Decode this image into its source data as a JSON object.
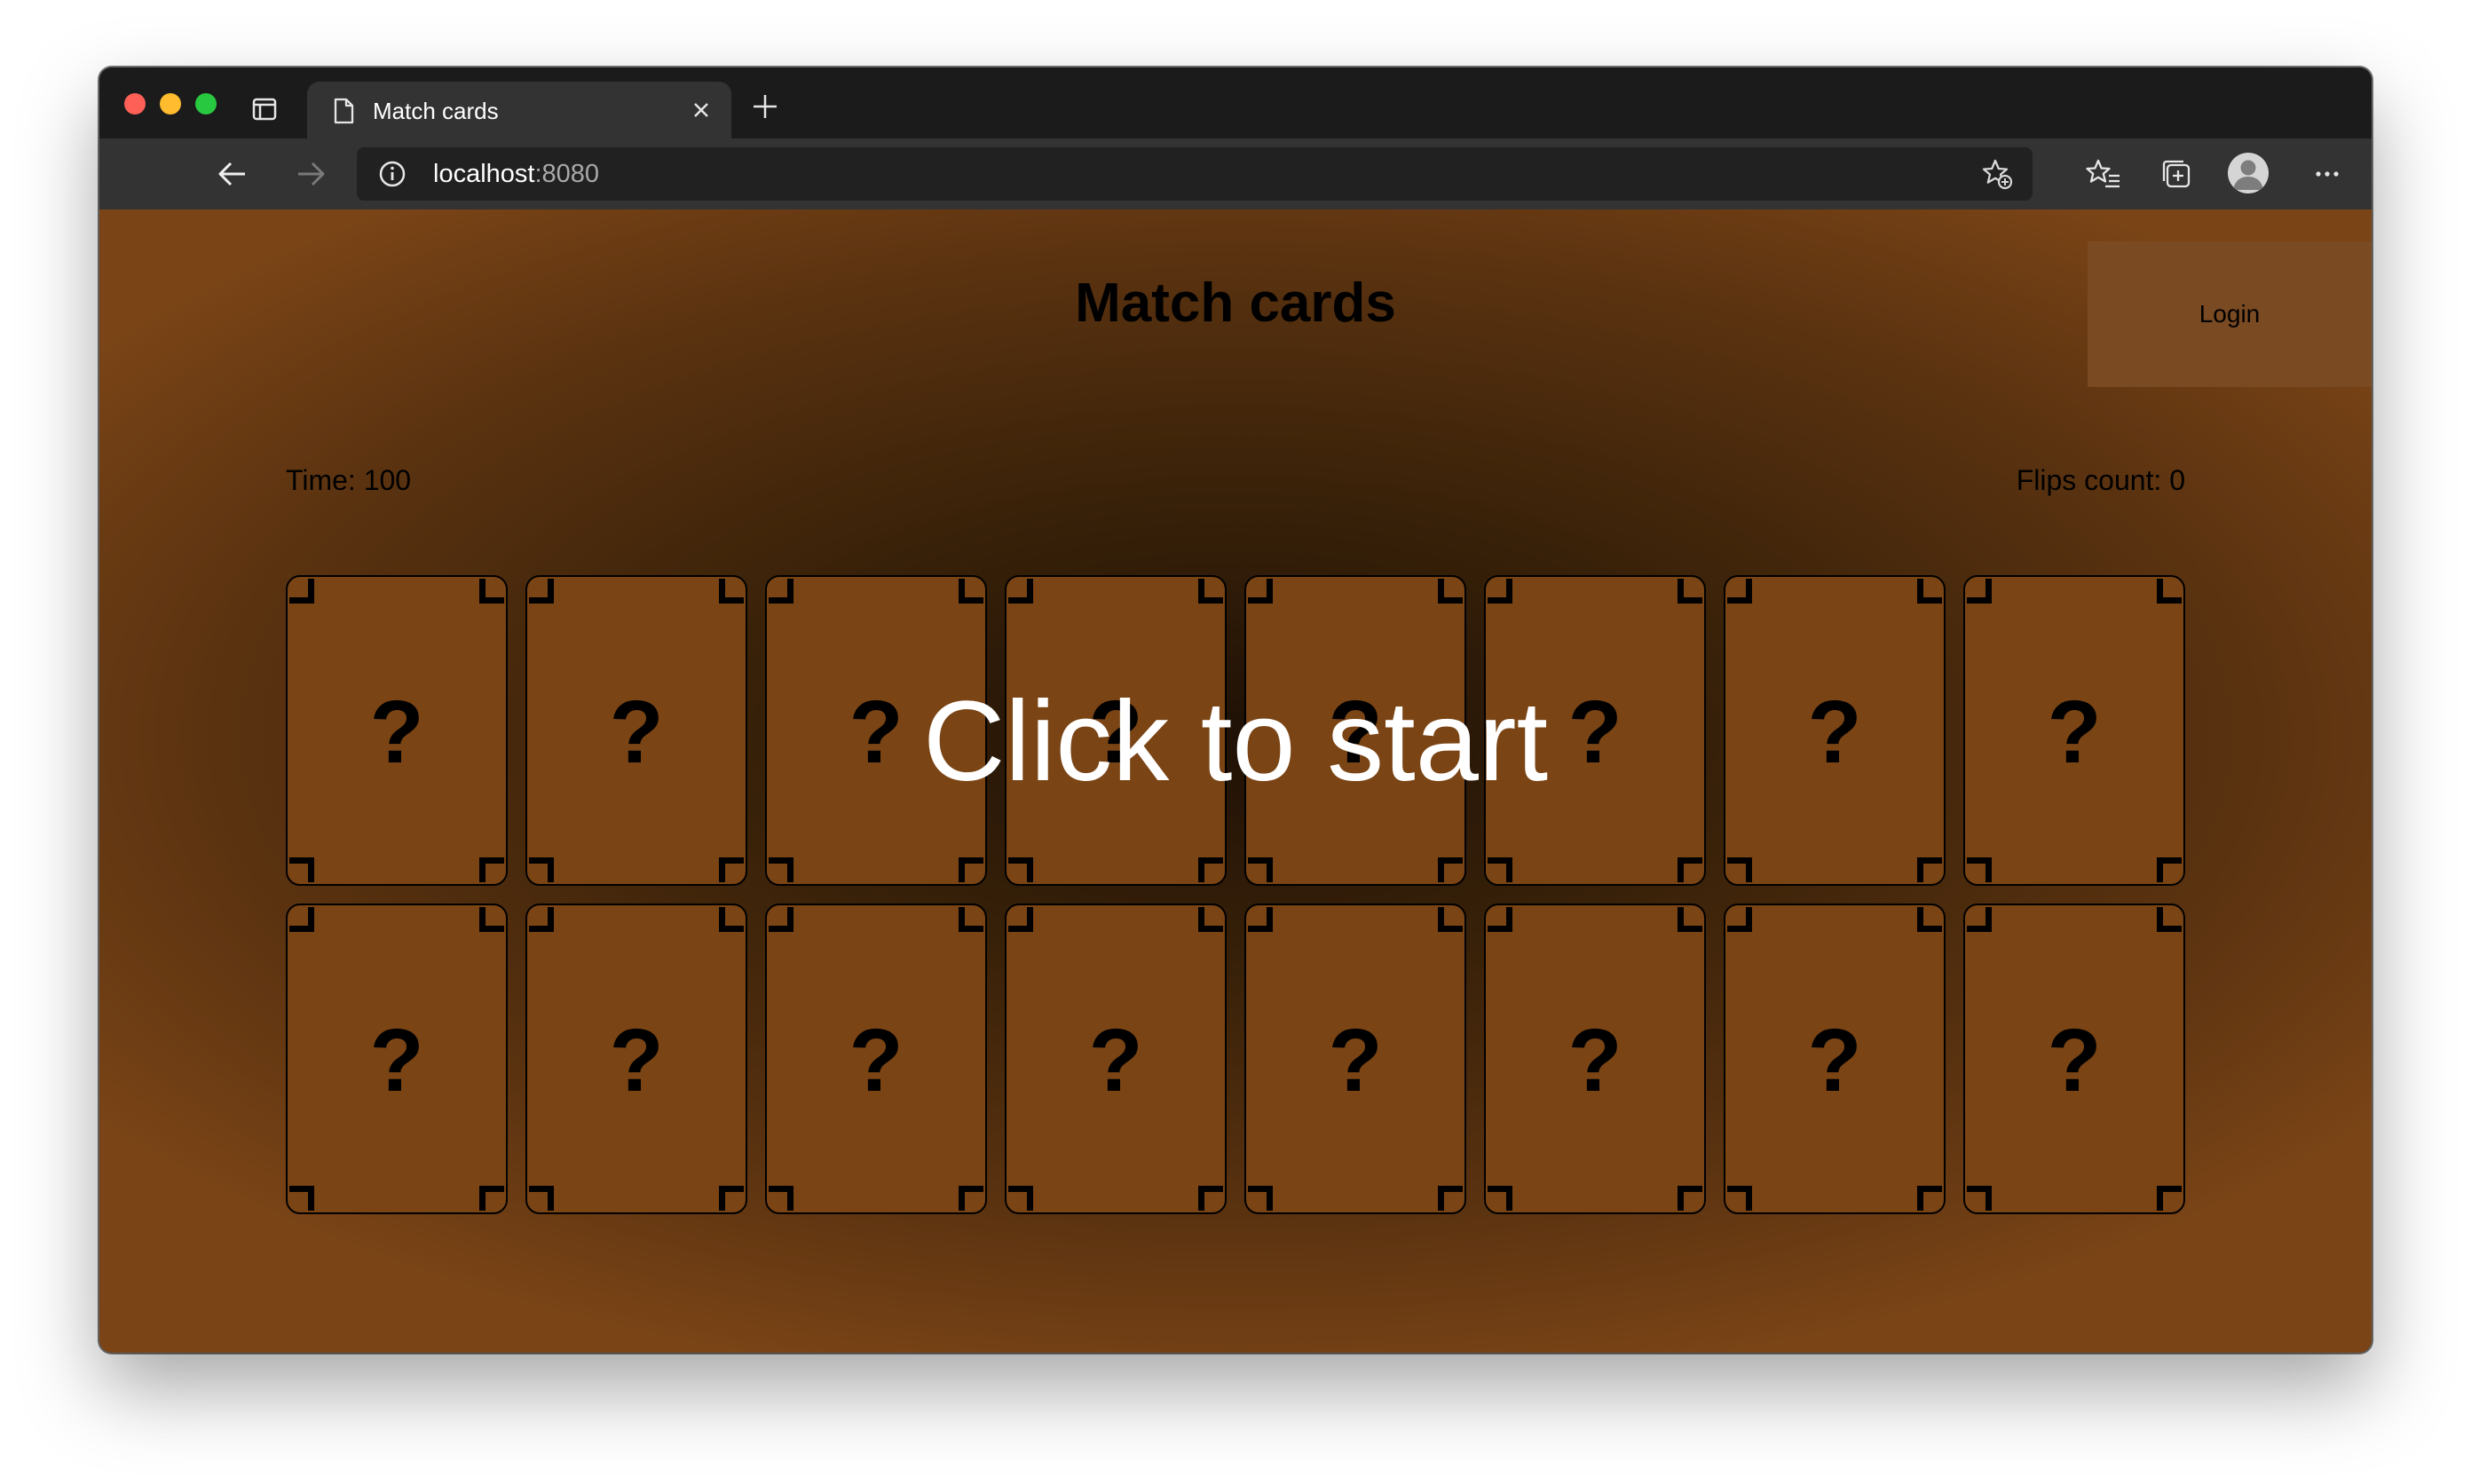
{
  "browser": {
    "tab_title": "Match cards",
    "url_host": "localhost",
    "url_port": ":8080",
    "icons": {
      "tab_actions": "tab-actions-icon",
      "page": "page-icon",
      "close": "close-icon",
      "new_tab": "plus-icon",
      "back": "back-arrow-icon",
      "forward": "forward-arrow-icon",
      "reload": "reload-icon",
      "info": "info-icon",
      "add_favorite": "star-plus-icon",
      "favorites": "favorites-icon",
      "collections": "collections-icon",
      "profile": "profile-avatar",
      "more": "more-icon"
    }
  },
  "page": {
    "title": "Match cards",
    "login_label": "Login",
    "time_label": "Time: 100",
    "flips_label": "Flips count: 0",
    "overlay": "Click to start",
    "card_face": "?",
    "card_rows": 2,
    "cards_per_row": 8,
    "colors": {
      "card_back": "#7a4414",
      "background_edge": "#7a4416",
      "background_center": "#1f1106",
      "login_bg": "#7a4a22"
    }
  }
}
